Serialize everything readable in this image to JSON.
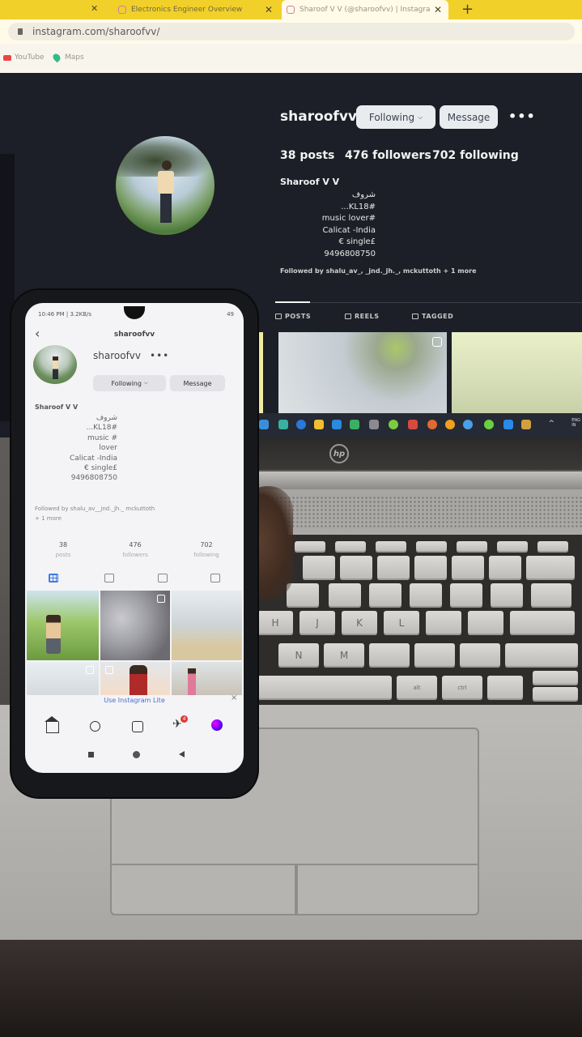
{
  "browser": {
    "tabs": [
      {
        "title": "Electronics Engineer Overview"
      },
      {
        "title": "Sharoof V V (@sharoofvv) | Instagra"
      }
    ],
    "new_tab": "+",
    "url": "instagram.com/sharoofvv/",
    "bookmarks": [
      "YouTube",
      "Maps"
    ]
  },
  "desktop_profile": {
    "username": "sharoofvv",
    "following_btn": "Following",
    "message_btn": "Message",
    "more": "•••",
    "posts": "38 posts",
    "followers": "476 followers",
    "following": "702 following",
    "full_name": "Sharoof V V",
    "bio": [
      "شروف",
      "...KL18#",
      "music lover#",
      "Calicat -India",
      "€ single£",
      "9496808750"
    ],
    "followed_by": "Followed by shalu_av_, _jnd._jh._, mckuttoth + 1 more",
    "tabs": [
      "POSTS",
      "REELS",
      "TAGGED"
    ]
  },
  "taskbar": {
    "lang": "ENG",
    "region": "IN",
    "overflow": "^"
  },
  "laptop": {
    "brand": "hp",
    "keys_row1": [
      "H",
      "J",
      "K",
      "L"
    ],
    "keys_row2": [
      "N",
      "M"
    ],
    "keys_row3": [
      "alt",
      "ctrl"
    ]
  },
  "phone": {
    "status_time": "10:46 PM | 3.2KB/s",
    "battery": "49",
    "header_username": "sharoofvv",
    "username": "sharoofvv",
    "more": "•••",
    "following_btn": "Following",
    "message_btn": "Message",
    "full_name": "Sharoof V V",
    "bio": [
      "شروف",
      "...KL18#",
      "music #",
      "lover",
      "Calicat -India",
      "€ single£",
      "9496808750"
    ],
    "followed_by": "Followed by shalu_av__jnd._jh._ mckuttoth",
    "followed_more": "+ 1 more",
    "stats": [
      {
        "value": "38",
        "label": "posts"
      },
      {
        "value": "476",
        "label": "followers"
      },
      {
        "value": "702",
        "label": "following"
      }
    ],
    "lite_banner": "Use Instagram Lite",
    "lite_close": "×",
    "dm_badge": "4"
  }
}
